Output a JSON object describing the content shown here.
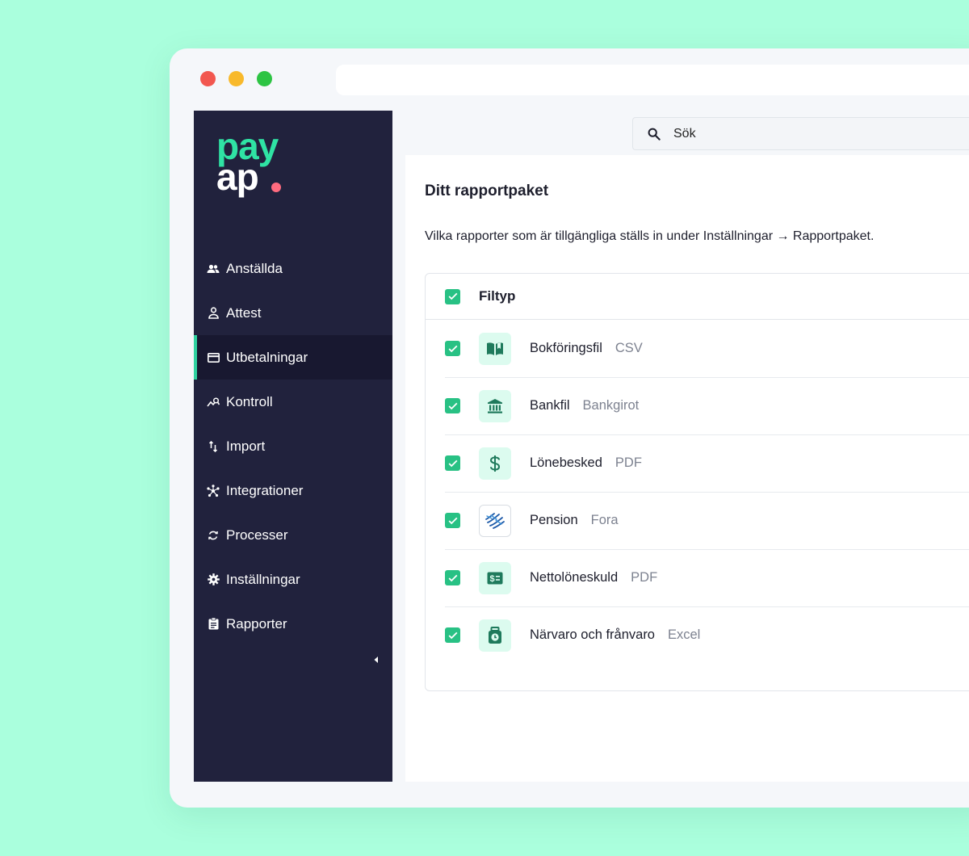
{
  "brand": {
    "line1": "pay",
    "line2": "ap"
  },
  "search": {
    "placeholder": "Sök"
  },
  "sidebar": {
    "items": [
      {
        "label": "Anställda",
        "icon": "people-icon"
      },
      {
        "label": "Attest",
        "icon": "person-outline-icon"
      },
      {
        "label": "Utbetalningar",
        "icon": "card-icon",
        "active": true
      },
      {
        "label": "Kontroll",
        "icon": "trend-search-icon"
      },
      {
        "label": "Import",
        "icon": "swap-vertical-icon"
      },
      {
        "label": "Integrationer",
        "icon": "hub-icon"
      },
      {
        "label": "Processer",
        "icon": "sync-icon"
      },
      {
        "label": "Inställningar",
        "icon": "gear-icon"
      },
      {
        "label": "Rapporter",
        "icon": "clipboard-icon"
      }
    ]
  },
  "panel": {
    "title": "Ditt rapportpaket",
    "subtitle": "Vilka rapporter som är tillgängliga ställs in under Inställningar → Rapportpaket.",
    "table_header": "Filtyp",
    "rows": [
      {
        "name": "Bokföringsfil",
        "type": "CSV",
        "icon": "book-icon",
        "checked": true
      },
      {
        "name": "Bankfil",
        "type": "Bankgirot",
        "icon": "bank-icon",
        "checked": true
      },
      {
        "name": "Lönebesked",
        "type": "PDF",
        "icon": "dollar-icon",
        "checked": true
      },
      {
        "name": "Pension",
        "type": "Fora",
        "icon": "fora-logo-icon",
        "checked": true
      },
      {
        "name": "Nettolöneskuld",
        "type": "PDF",
        "icon": "money-bill-icon",
        "checked": true
      },
      {
        "name": "Närvaro och frånvaro",
        "type": "Excel",
        "icon": "time-bag-icon",
        "checked": true
      }
    ]
  },
  "colors": {
    "background": "#aaffdd",
    "sidebar": "#21223d",
    "accent": "#2fd3a0",
    "brand_green": "#2fe3a4",
    "brand_dot": "#ff6b7f",
    "checkbox": "#28c184",
    "icon_green": "#1f7a5c"
  }
}
